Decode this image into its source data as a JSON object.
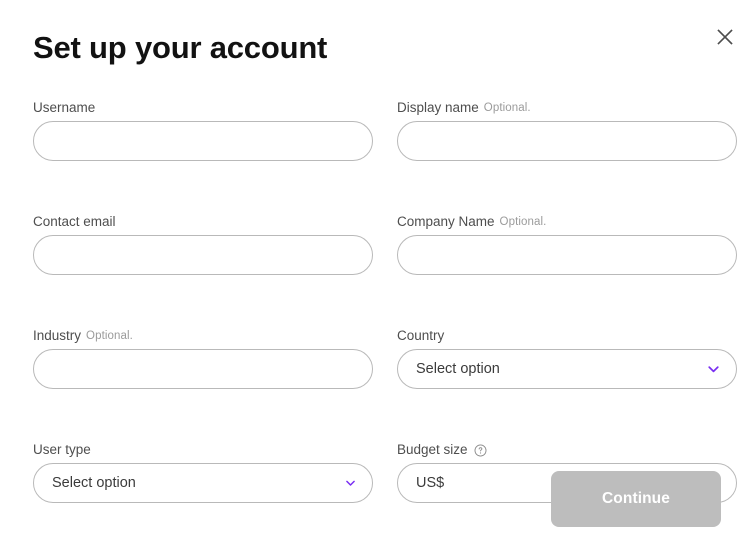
{
  "dialog": {
    "title": "Set up your account",
    "close_icon": "close-icon"
  },
  "colors": {
    "accent_purple": "#7a2ff2",
    "label_grey": "#4e4e4e",
    "optional_grey": "#9b9b9b",
    "border_grey": "#b9b9b9",
    "button_disabled_grey": "#bdbdbd",
    "title_black": "#121212"
  },
  "form": {
    "rows": [
      {
        "left": {
          "label": "Username",
          "optional": "",
          "type": "text",
          "value": "",
          "placeholder": ""
        },
        "right": {
          "label": "Display name",
          "optional": "Optional.",
          "type": "text",
          "value": "",
          "placeholder": ""
        }
      },
      {
        "left": {
          "label": "Contact email",
          "optional": "",
          "type": "text",
          "value": "",
          "placeholder": ""
        },
        "right": {
          "label": "Company Name",
          "optional": "Optional.",
          "type": "text",
          "value": "",
          "placeholder": ""
        }
      },
      {
        "left": {
          "label": "Industry",
          "optional": "Optional.",
          "type": "text",
          "value": "",
          "placeholder": ""
        },
        "right": {
          "label": "Country",
          "optional": "",
          "type": "select",
          "value": "Select option",
          "chevron_icon": "chevron-down-icon"
        }
      },
      {
        "left": {
          "label": "User type",
          "optional": "",
          "type": "select",
          "value": "Select option",
          "chevron_icon": "chevron-down-icon"
        },
        "right": {
          "label": "Budget size",
          "optional": "",
          "help_icon": "help-circle-icon",
          "type": "text",
          "value": "US$",
          "placeholder": ""
        }
      }
    ]
  },
  "footer": {
    "continue_label": "Continue"
  }
}
